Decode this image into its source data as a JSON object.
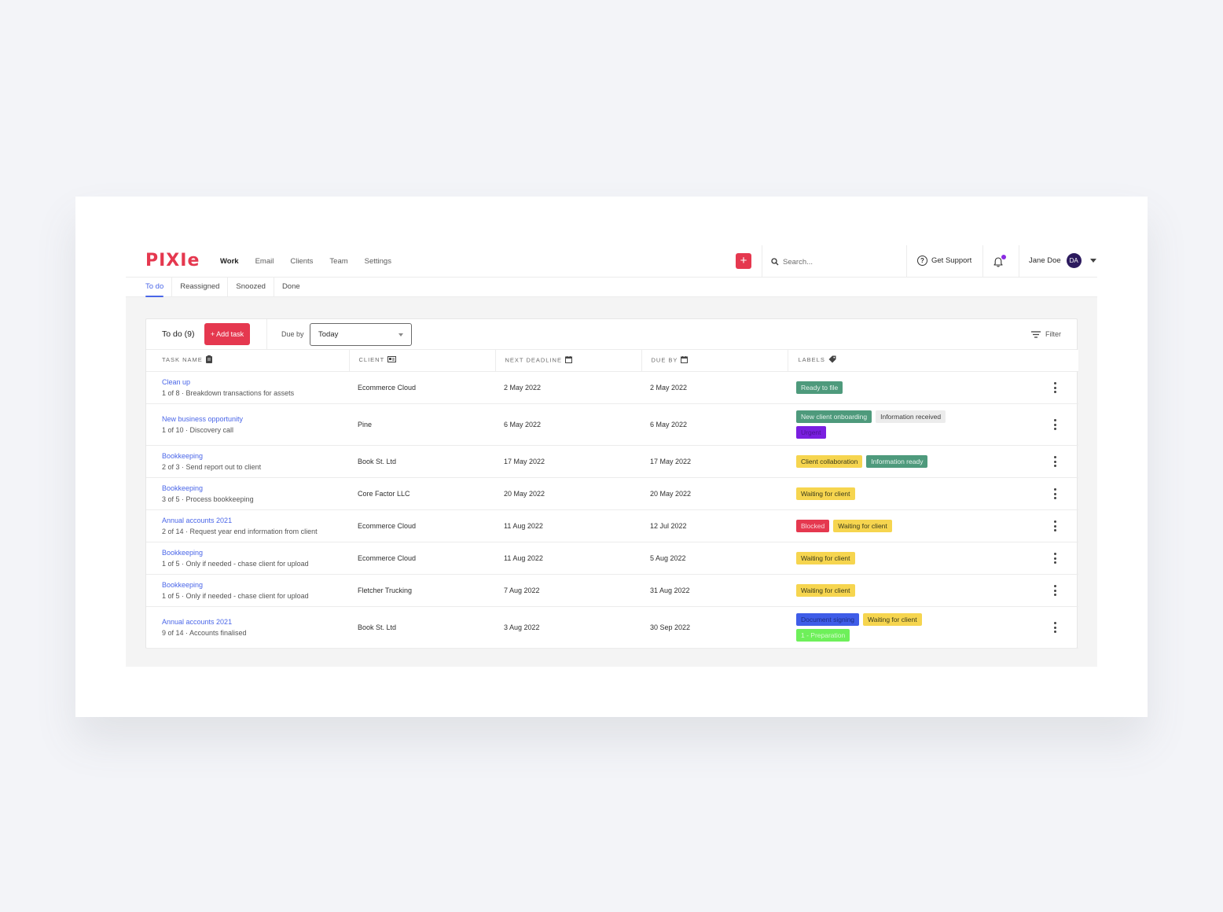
{
  "brand": {
    "logo_text": "PIXIe",
    "accent": "#e5384f"
  },
  "nav": {
    "links": [
      {
        "label": "Work",
        "active": true
      },
      {
        "label": "Email",
        "active": false
      },
      {
        "label": "Clients",
        "active": false
      },
      {
        "label": "Team",
        "active": false
      },
      {
        "label": "Settings",
        "active": false
      }
    ],
    "add_icon": "plus-icon",
    "search_placeholder": "Search...",
    "support_label": "Get Support",
    "notification_badge_color": "#8a2be2",
    "user_name": "Jane Doe",
    "user_initials": "DA"
  },
  "subtabs": [
    {
      "label": "To do",
      "active": true
    },
    {
      "label": "Reassigned",
      "active": false
    },
    {
      "label": "Snoozed",
      "active": false
    },
    {
      "label": "Done",
      "active": false
    }
  ],
  "toolbar": {
    "title": "To do (9)",
    "add_task_label": "+ Add task",
    "due_by_label": "Due by",
    "due_by_value": "Today",
    "filter_label": "Filter"
  },
  "table": {
    "columns": [
      {
        "label": "TASK NAME",
        "icon": "clipboard-icon"
      },
      {
        "label": "CLIENT",
        "icon": "id-card-icon"
      },
      {
        "label": "NEXT DEADLINE",
        "icon": "calendar-icon"
      },
      {
        "label": "DUE BY",
        "icon": "calendar-icon"
      },
      {
        "label": "LABELS",
        "icon": "tag-icon"
      }
    ],
    "rows": [
      {
        "task": "Clean up",
        "step": "1 of 8 · Breakdown transactions for assets",
        "client": "Ecommerce Cloud",
        "next_deadline": "2 May 2022",
        "due_by": "2 May 2022",
        "labels": [
          {
            "text": "Ready to file",
            "bg": "#4e9a7c",
            "fg": "#e8f4ee"
          }
        ]
      },
      {
        "task": "New business opportunity",
        "step": "1 of 10 · Discovery call",
        "client": "Pine",
        "next_deadline": "6 May 2022",
        "due_by": "6 May 2022",
        "labels": [
          {
            "text": "New client onboarding",
            "bg": "#4e9a7c",
            "fg": "#e8f4ee"
          },
          {
            "text": "Information received",
            "bg": "#ececec",
            "fg": "#3a3a3a"
          },
          {
            "text": "Urgent",
            "bg": "#7a1fe0",
            "fg": "#4a1190"
          }
        ]
      },
      {
        "task": "Bookkeeping",
        "step": "2 of 3 · Send report out to client",
        "client": "Book St. Ltd",
        "next_deadline": "17 May 2022",
        "due_by": "17 May 2022",
        "labels": [
          {
            "text": "Client collaboration",
            "bg": "#f6d54f",
            "fg": "#3a3a1a"
          },
          {
            "text": "Information ready",
            "bg": "#4e9a7c",
            "fg": "#e8f4ee"
          }
        ]
      },
      {
        "task": "Bookkeeping",
        "step": "3 of 5 · Process bookkeeping",
        "client": "Core Factor LLC",
        "next_deadline": "20 May 2022",
        "due_by": "20 May 2022",
        "labels": [
          {
            "text": "Waiting for client",
            "bg": "#f6d54f",
            "fg": "#3a3a1a"
          }
        ]
      },
      {
        "task": "Annual accounts 2021",
        "step": "2 of 14 · Request year end information from client",
        "client": "Ecommerce Cloud",
        "next_deadline": "11 Aug 2022",
        "due_by": "12 Jul 2022",
        "labels": [
          {
            "text": "Blocked",
            "bg": "#e5384f",
            "fg": "#fbd6dc"
          },
          {
            "text": "Waiting for client",
            "bg": "#f6d54f",
            "fg": "#3a3a1a"
          }
        ]
      },
      {
        "task": "Bookkeeping",
        "step": "1 of 5 · Only if needed - chase client for upload",
        "client": "Ecommerce Cloud",
        "next_deadline": "11 Aug 2022",
        "due_by": "5 Aug 2022",
        "labels": [
          {
            "text": "Waiting for client",
            "bg": "#f6d54f",
            "fg": "#3a3a1a"
          }
        ]
      },
      {
        "task": "Bookkeeping",
        "step": "1 of 5 · Only if needed - chase client for upload",
        "client": "Fletcher Trucking",
        "next_deadline": "7 Aug 2022",
        "due_by": "31 Aug 2022",
        "labels": [
          {
            "text": "Waiting for client",
            "bg": "#f6d54f",
            "fg": "#3a3a1a"
          }
        ]
      },
      {
        "task": "Annual accounts 2021",
        "step": "9 of 14 · Accounts finalised",
        "client": "Book St. Ltd",
        "next_deadline": "3 Aug 2022",
        "due_by": "30 Sep 2022",
        "labels": [
          {
            "text": "Document signing",
            "bg": "#3f5de8",
            "fg": "#1e2f86"
          },
          {
            "text": "Waiting for client",
            "bg": "#f6d54f",
            "fg": "#3a3a1a"
          },
          {
            "text": "1 - Preparation",
            "bg": "#6ef05a",
            "fg": "#d8fbd2"
          }
        ]
      }
    ],
    "row_menu_icon": "more-vertical-icon"
  }
}
